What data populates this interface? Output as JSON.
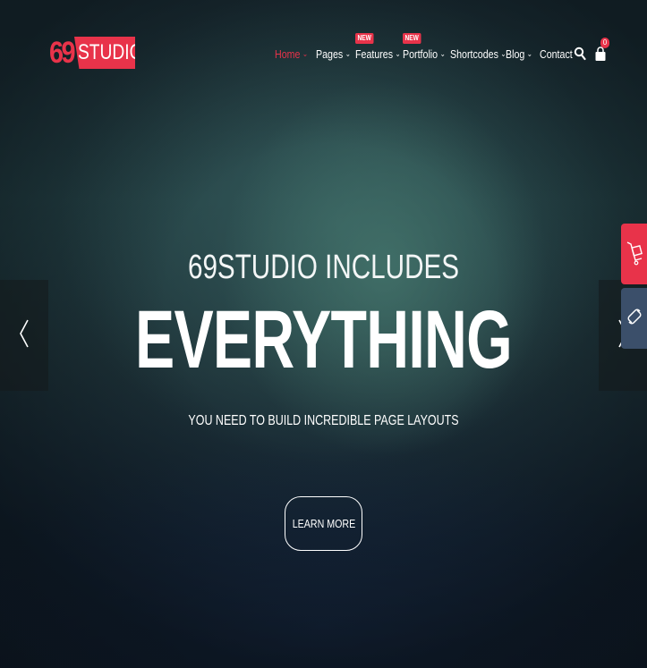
{
  "logo": {
    "number": "69",
    "text": "STUDIO"
  },
  "nav": {
    "items": [
      {
        "label": "Home",
        "active": true,
        "dropdown": true,
        "badge": ""
      },
      {
        "label": "Pages",
        "active": false,
        "dropdown": true,
        "badge": ""
      },
      {
        "label": "Features",
        "active": false,
        "dropdown": true,
        "badge": "NEW"
      },
      {
        "label": "Portfolio",
        "active": false,
        "dropdown": true,
        "badge": "NEW"
      },
      {
        "label": "Shortcodes",
        "active": false,
        "dropdown": true,
        "badge": ""
      },
      {
        "label": "Blog",
        "active": false,
        "dropdown": true,
        "badge": ""
      },
      {
        "label": "Contact",
        "active": false,
        "dropdown": false,
        "badge": ""
      }
    ],
    "cart_count": "0",
    "search_icon": "search-icon",
    "cart_icon": "shopping-bag-icon"
  },
  "hero": {
    "subtitle": "69STUDIO INCLUDES",
    "title": "EVERYTHING",
    "description": "YOU NEED TO BUILD INCREDIBLE PAGE LAYOUTS",
    "button_label": "LEARN MORE"
  },
  "slider": {
    "prev_icon": "chevron-left-icon",
    "next_icon": "chevron-right-icon"
  },
  "side_buttons": {
    "cart_icon": "cart-icon",
    "link_icon": "link-icon"
  },
  "colors": {
    "accent": "#e8334a",
    "side_secondary": "#3b4f6a"
  }
}
